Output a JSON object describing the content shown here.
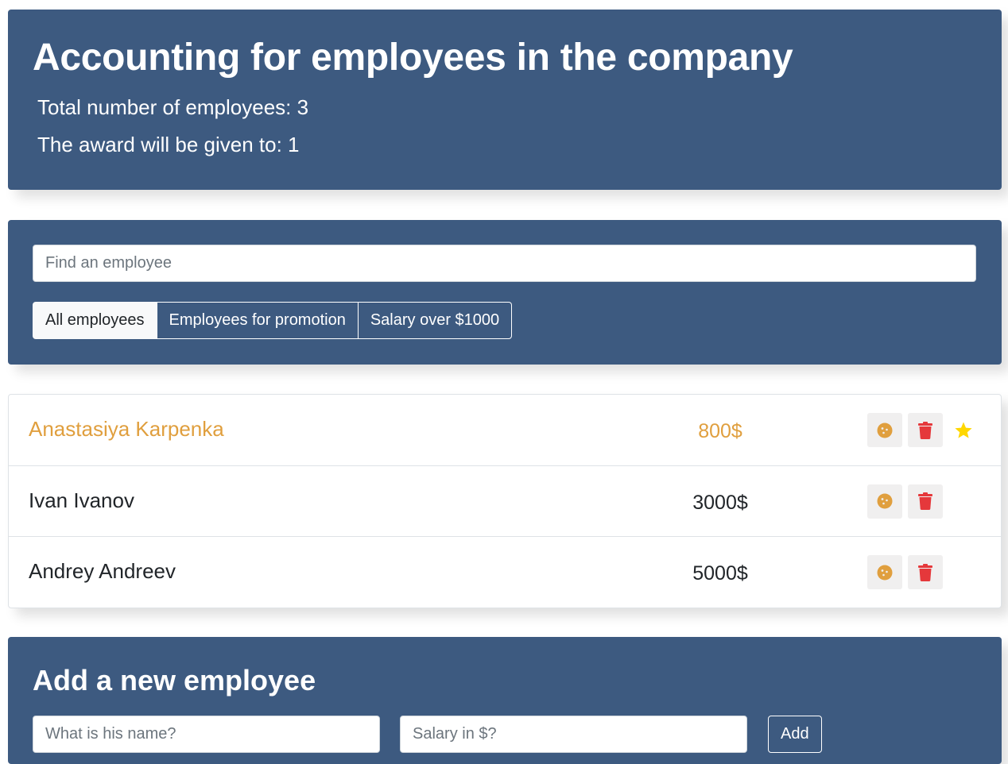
{
  "header": {
    "title": "Accounting for employees in the company",
    "total_label": "Total number of employees: 3",
    "award_label": "The award will be given to: 1"
  },
  "search": {
    "placeholder": "Find an employee",
    "value": ""
  },
  "filters": [
    {
      "label": "All employees",
      "active": true
    },
    {
      "label": "Employees for promotion",
      "active": false
    },
    {
      "label": "Salary over $1000",
      "active": false
    }
  ],
  "employees": [
    {
      "name": "Anastasiya Karpenka",
      "salary": "800$",
      "increase": true,
      "rise": true
    },
    {
      "name": "Ivan Ivanov",
      "salary": "3000$",
      "increase": false,
      "rise": false
    },
    {
      "name": "Andrey Andreev",
      "salary": "5000$",
      "increase": false,
      "rise": false
    }
  ],
  "add_form": {
    "title": "Add a new employee",
    "name_placeholder": "What is his name?",
    "salary_placeholder": "Salary in $?",
    "submit_label": "Add"
  },
  "colors": {
    "panel": "#3d5a80",
    "increase": "#e09f3e",
    "trash": "#e5383b",
    "star": "#ffd700"
  },
  "icons": {
    "cookie": "cookie-icon",
    "trash": "trash-icon",
    "star": "star-icon"
  }
}
